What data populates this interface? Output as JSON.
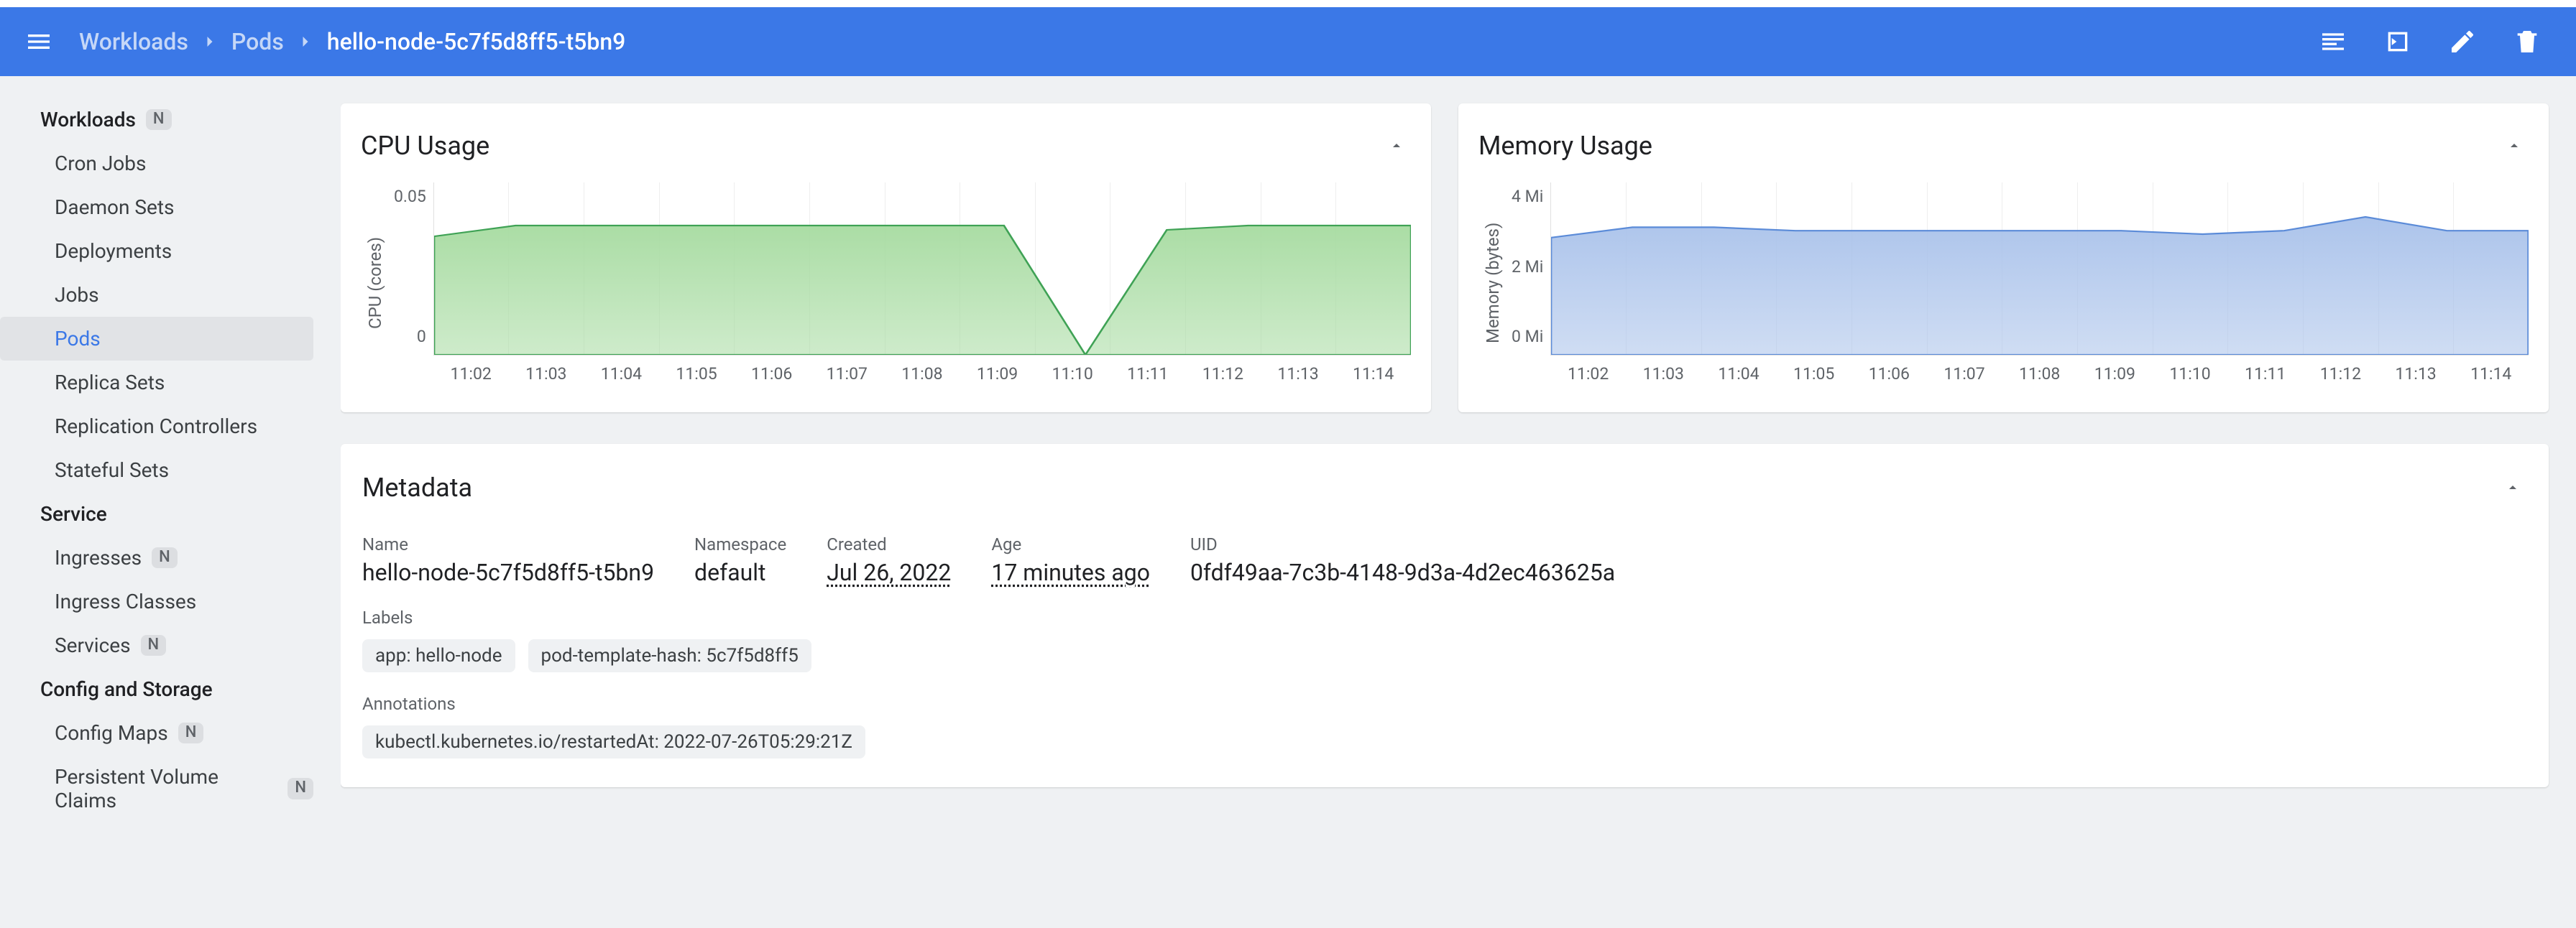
{
  "header": {
    "crumbs": [
      "Workloads",
      "Pods",
      "hello-node-5c7f5d8ff5-t5bn9"
    ]
  },
  "sidebar": {
    "badge": "N",
    "sections": [
      {
        "title": "Workloads",
        "items": [
          "Cron Jobs",
          "Daemon Sets",
          "Deployments",
          "Jobs",
          "Pods",
          "Replica Sets",
          "Replication Controllers",
          "Stateful Sets"
        ]
      },
      {
        "title": "Service",
        "items": [
          "Ingresses",
          "Ingress Classes",
          "Services"
        ]
      },
      {
        "title": "Config and Storage",
        "items": [
          "Config Maps",
          "Persistent Volume Claims"
        ]
      }
    ]
  },
  "charts": {
    "cpu": {
      "title": "CPU Usage",
      "ylabel": "CPU (cores)",
      "yticks": [
        "0.05",
        "0"
      ],
      "xticks": [
        "11:02",
        "11:03",
        "11:04",
        "11:05",
        "11:06",
        "11:07",
        "11:08",
        "11:09",
        "11:10",
        "11:11",
        "11:12",
        "11:13",
        "11:14"
      ],
      "color_fill": "#a6dba0",
      "color_stroke": "#3fa255"
    },
    "memory": {
      "title": "Memory Usage",
      "ylabel": "Memory (bytes)",
      "yticks": [
        "4 Mi",
        "2 Mi",
        "0 Mi"
      ],
      "xticks": [
        "11:02",
        "11:03",
        "11:04",
        "11:05",
        "11:06",
        "11:07",
        "11:08",
        "11:09",
        "11:10",
        "11:11",
        "11:12",
        "11:13",
        "11:14"
      ],
      "color_fill": "#a8c1ea",
      "color_stroke": "#5b8bd8"
    }
  },
  "chart_data": [
    {
      "type": "area",
      "title": "CPU Usage",
      "ylabel": "CPU (cores)",
      "ylim": [
        0,
        0.08
      ],
      "x": [
        "11:02",
        "11:03",
        "11:04",
        "11:05",
        "11:06",
        "11:07",
        "11:08",
        "11:09",
        "11:10",
        "11:11",
        "11:12",
        "11:13",
        "11:14"
      ],
      "values": [
        0.055,
        0.06,
        0.06,
        0.06,
        0.06,
        0.06,
        0.06,
        0.06,
        0.0,
        0.058,
        0.06,
        0.06,
        0.06
      ]
    },
    {
      "type": "area",
      "title": "Memory Usage",
      "ylabel": "Memory (bytes)",
      "ylim": [
        0,
        5
      ],
      "unit": "Mi",
      "x": [
        "11:02",
        "11:03",
        "11:04",
        "11:05",
        "11:06",
        "11:07",
        "11:08",
        "11:09",
        "11:10",
        "11:11",
        "11:12",
        "11:13",
        "11:14"
      ],
      "values": [
        3.4,
        3.7,
        3.7,
        3.6,
        3.6,
        3.6,
        3.6,
        3.6,
        3.5,
        3.6,
        4.0,
        3.6,
        3.6
      ]
    }
  ],
  "metadata": {
    "title": "Metadata",
    "fields": [
      {
        "label": "Name",
        "value": "hello-node-5c7f5d8ff5-t5bn9"
      },
      {
        "label": "Namespace",
        "value": "default"
      },
      {
        "label": "Created",
        "value": "Jul 26, 2022"
      },
      {
        "label": "Age",
        "value": "17 minutes ago"
      },
      {
        "label": "UID",
        "value": "0fdf49aa-7c3b-4148-9d3a-4d2ec463625a"
      }
    ],
    "labels_title": "Labels",
    "labels": [
      "app: hello-node",
      "pod-template-hash: 5c7f5d8ff5"
    ],
    "annotations_title": "Annotations",
    "annotations": [
      "kubectl.kubernetes.io/restartedAt: 2022-07-26T05:29:21Z"
    ]
  }
}
